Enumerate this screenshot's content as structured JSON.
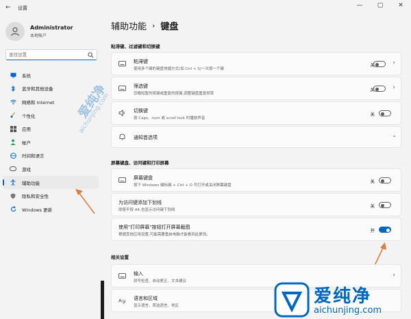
{
  "window": {
    "title": "设置",
    "controls": [
      "—",
      "▢",
      "✕"
    ]
  },
  "profile": {
    "name": "Administrator",
    "subtitle": "本地帐户"
  },
  "search": {
    "placeholder": "查找设置"
  },
  "nav": [
    {
      "label": "系统",
      "icon": "monitor-icon"
    },
    {
      "label": "蓝牙和其他设备",
      "icon": "bluetooth-icon"
    },
    {
      "label": "网络和 Internet",
      "icon": "wifi-icon"
    },
    {
      "label": "个性化",
      "icon": "brush-icon"
    },
    {
      "label": "应用",
      "icon": "apps-icon"
    },
    {
      "label": "帐户",
      "icon": "person-icon"
    },
    {
      "label": "时间和语言",
      "icon": "globe-icon"
    },
    {
      "label": "游戏",
      "icon": "gamepad-icon"
    },
    {
      "label": "辅助功能",
      "icon": "accessibility-icon",
      "active": true
    },
    {
      "label": "隐私和安全性",
      "icon": "shield-icon"
    },
    {
      "label": "Windows 更新",
      "icon": "update-icon"
    }
  ],
  "breadcrumb": {
    "parent": "辅助功能",
    "separator": "›",
    "current": "键盘"
  },
  "sections": {
    "sticky": "粘滞键、过滤键和切换键",
    "screen_keyboard": "屏幕键盘、访问键和打印屏幕",
    "related": "相关设置"
  },
  "cards": {
    "sticky_keys": {
      "title": "粘滞键",
      "desc": "使用多个键的键盘快捷方式(如 Ctrl + S)一次按一个键",
      "state": "关"
    },
    "filter_keys": {
      "title": "筛选键",
      "desc": "忽略短暂的按键或重复的按键,调整键盘重复频率",
      "state": "关"
    },
    "toggle_keys": {
      "title": "切换键",
      "desc": "按 Caps、num 或 scroll lock 时播放声音",
      "state": "关"
    },
    "notifications": {
      "title": "通知首选项"
    },
    "onscreen_keyboard": {
      "title": "屏幕键盘",
      "desc": "按下 Windows 徽标键 + Ctrl + O 可打开或关闭屏幕键盘",
      "state": "关"
    },
    "underline_access": {
      "title": "为访问键添加下划线",
      "desc": "即使不按 Alt,也显示访问键下划线",
      "state": "关"
    },
    "print_screen": {
      "title": "使用\"打印屏幕\"按钮打开屏幕截图",
      "desc": "根据其他应用设置,可能需要重启电脑才能看到此更改。",
      "state": "开"
    },
    "input": {
      "title": "输入",
      "desc": "拼写检查、自动更正、文本建议"
    },
    "language": {
      "title": "语言和区域",
      "desc": "显示语言、首选语言、地区"
    }
  },
  "watermark": {
    "text_cn": "爱纯净",
    "text_url": "aichunjing.com"
  },
  "colors": {
    "accent": "#0067c0",
    "arrow": "#e07b39"
  }
}
